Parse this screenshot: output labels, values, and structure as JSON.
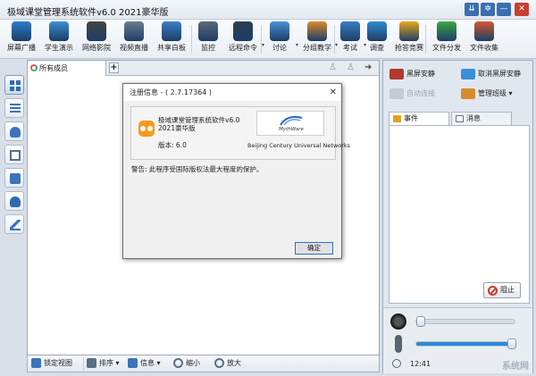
{
  "window": {
    "title": "极域课堂管理系统软件v6.0 2021豪华版",
    "controls": {
      "help": "⇊",
      "settings": "✲",
      "minimize": "—",
      "close": "✕"
    }
  },
  "toolbar": [
    {
      "id": "screen-broadcast",
      "label": "屏幕广播",
      "icon": "monitor-broadcast-icon",
      "color": "#2d7cc9"
    },
    {
      "id": "student-demo",
      "label": "学生演示",
      "icon": "student-demo-icon",
      "color": "#3a8fd6"
    },
    {
      "id": "network-video",
      "label": "网络影院",
      "icon": "film-reel-icon",
      "color": "#444444"
    },
    {
      "id": "video-live",
      "label": "视频直播",
      "icon": "webcam-icon",
      "color": "#6a7c8e"
    },
    {
      "id": "shared-whiteboard",
      "label": "共享白板",
      "icon": "whiteboard-icon",
      "color": "#3b7ec7"
    },
    {
      "id": "monitor",
      "label": "监控",
      "icon": "monitor-person-icon",
      "color": "#5a6a7a"
    },
    {
      "id": "remote-command",
      "label": "远程命令",
      "icon": "terminal-icon",
      "color": "#2c3e50",
      "dropdown": true
    },
    {
      "id": "discussion",
      "label": "讨论",
      "icon": "chat-bubbles-icon",
      "color": "#4a90d9",
      "dropdown": true
    },
    {
      "id": "group-teaching",
      "label": "分组教学",
      "icon": "group-users-icon",
      "color": "#d98a2b",
      "dropdown": true
    },
    {
      "id": "exam",
      "label": "考试",
      "icon": "exam-paper-icon",
      "color": "#3a7dc4",
      "dropdown": true
    },
    {
      "id": "survey",
      "label": "调查",
      "icon": "survey-chart-icon",
      "color": "#2f8bd0"
    },
    {
      "id": "quick-answer",
      "label": "抢答竞赛",
      "icon": "star-person-icon",
      "color": "#e8a81a"
    },
    {
      "id": "file-distribute",
      "label": "文件分发",
      "icon": "file-send-icon",
      "color": "#3aa843"
    },
    {
      "id": "file-collect",
      "label": "文件收集",
      "icon": "file-collect-icon",
      "color": "#d15a2a"
    }
  ],
  "main": {
    "tab": "所有成员",
    "tab_add": "+"
  },
  "bottombar": {
    "lock_view": "锁定视图",
    "sort": "排序",
    "info": "信息",
    "zoom_out": "缩小",
    "zoom_in": "放大"
  },
  "right_panel": {
    "black_screen": "黑屏安静",
    "cancel_black_screen": "取消黑屏安静",
    "auto_connect": "自动连接",
    "manage_class": "管理班级",
    "tabs": [
      "事件",
      "消息"
    ],
    "block_button": "阻止",
    "clock": "12:41",
    "volume_level": 0.04,
    "mic_level": 0.96,
    "watermark": "系统网"
  },
  "dialog": {
    "title": "注册信息 - ( 2.7.17364 )",
    "close": "✕",
    "product_name": "极域课堂管理系统软件v6.0 2021豪华版",
    "version": "版本: 6.0",
    "logo_text": "MythWare",
    "company": "Beijing Century Universal Networks",
    "warning": "警告: 此程序受国际版权法最大程度的保护。",
    "ok_button": "确定"
  }
}
